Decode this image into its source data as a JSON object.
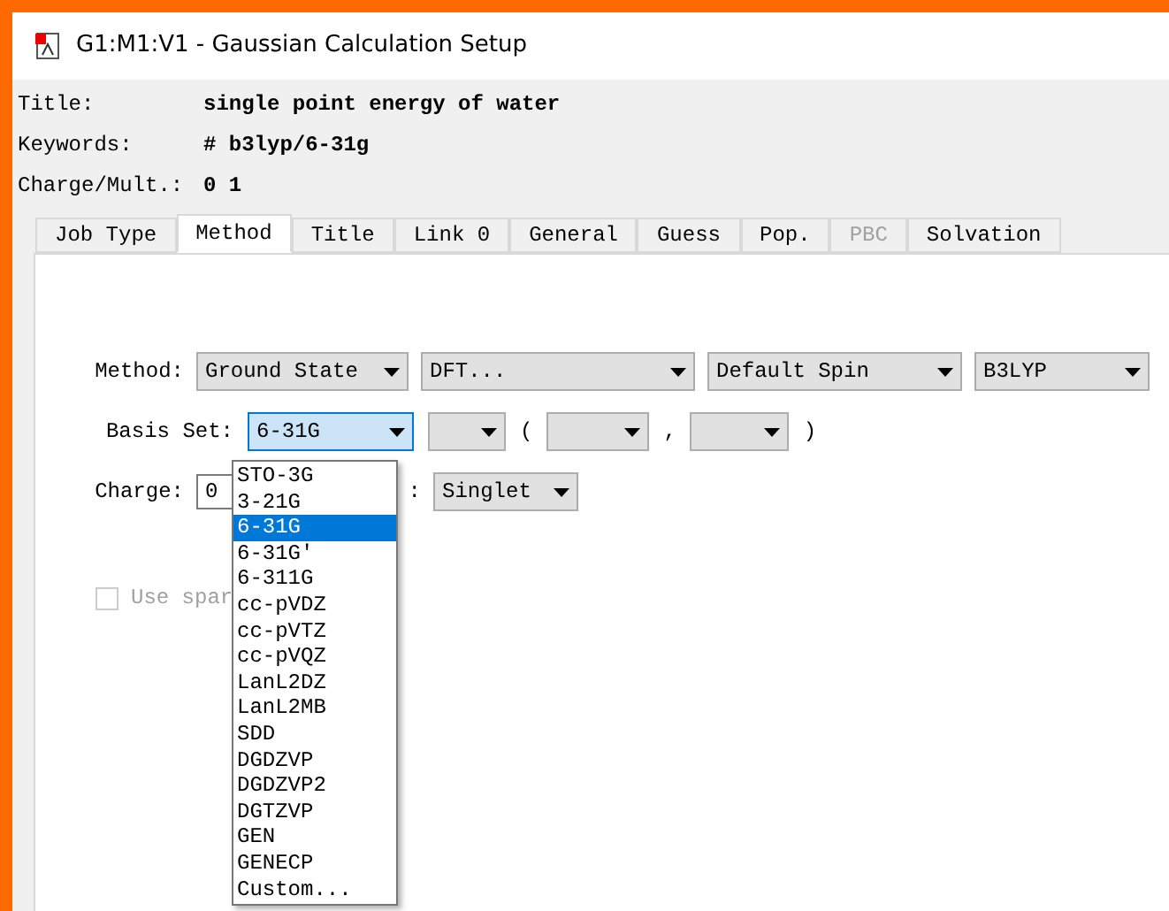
{
  "window": {
    "title": "G1:M1:V1 - Gaussian Calculation Setup"
  },
  "summary": [
    {
      "label": "Title:",
      "value": "single point energy of water"
    },
    {
      "label": "Keywords:",
      "value": "# b3lyp/6-31g"
    },
    {
      "label": "Charge/Mult.:",
      "value": "0 1"
    }
  ],
  "tabs": [
    {
      "label": "Job Type",
      "selected": false,
      "disabled": false
    },
    {
      "label": "Method",
      "selected": true,
      "disabled": false
    },
    {
      "label": "Title",
      "selected": false,
      "disabled": false
    },
    {
      "label": "Link 0",
      "selected": false,
      "disabled": false
    },
    {
      "label": "General",
      "selected": false,
      "disabled": false
    },
    {
      "label": "Guess",
      "selected": false,
      "disabled": false
    },
    {
      "label": "Pop.",
      "selected": false,
      "disabled": false
    },
    {
      "label": "PBC",
      "selected": false,
      "disabled": true
    },
    {
      "label": "Solvation",
      "selected": false,
      "disabled": false
    }
  ],
  "method": {
    "label": "Method:",
    "state": "Ground State",
    "type": "DFT...",
    "spin": "Default Spin",
    "functional": "B3LYP"
  },
  "basis_set": {
    "label": "Basis Set:",
    "value": "6-31G",
    "open_paren": "(",
    "comma": ",",
    "close_paren": ")",
    "options": [
      {
        "label": "STO-3G",
        "selected": false
      },
      {
        "label": "3-21G",
        "selected": false
      },
      {
        "label": "6-31G",
        "selected": true
      },
      {
        "label": "6-31G'",
        "selected": false
      },
      {
        "label": "6-311G",
        "selected": false
      },
      {
        "label": "cc-pVDZ",
        "selected": false
      },
      {
        "label": "cc-pVTZ",
        "selected": false
      },
      {
        "label": "cc-pVQZ",
        "selected": false
      },
      {
        "label": "LanL2DZ",
        "selected": false
      },
      {
        "label": "LanL2MB",
        "selected": false
      },
      {
        "label": "SDD",
        "selected": false
      },
      {
        "label": "DGDZVP",
        "selected": false
      },
      {
        "label": "DGDZVP2",
        "selected": false
      },
      {
        "label": "DGTZVP",
        "selected": false
      },
      {
        "label": "GEN",
        "selected": false
      },
      {
        "label": "GENECP",
        "selected": false
      },
      {
        "label": "Custom...",
        "selected": false
      }
    ]
  },
  "charge": {
    "label": "Charge:",
    "value": "0",
    "spin_label": ":",
    "spin_value": "Singlet"
  },
  "checkbox": {
    "label": "Use spar",
    "checked": false,
    "disabled": true
  }
}
